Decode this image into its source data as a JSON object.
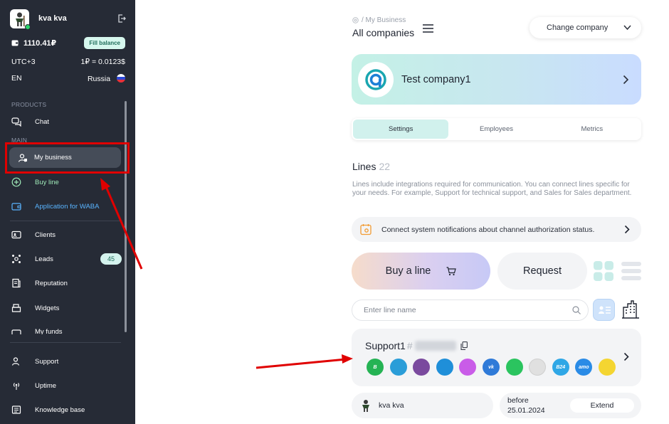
{
  "sidebar": {
    "user_name": "kva kva",
    "balance": "1110.41₽",
    "fill_balance_label": "Fill balance",
    "timezone": "UTC+3",
    "rate": "1₽ = 0.0123$",
    "language": "EN",
    "country": "Russia",
    "products_label": "PRODUCTS",
    "main_label": "MAIN",
    "items": [
      {
        "label": "Chat",
        "icon": "chat-icon"
      },
      {
        "label": "My business",
        "icon": "business-icon",
        "active": true
      },
      {
        "label": "Buy line",
        "icon": "plus-circle-icon"
      },
      {
        "label": "Application for WABA",
        "icon": "wallet-icon"
      },
      {
        "label": "Clients",
        "icon": "id-card-icon"
      },
      {
        "label": "Leads",
        "icon": "leads-icon",
        "badge": "45"
      },
      {
        "label": "Reputation",
        "icon": "reputation-icon"
      },
      {
        "label": "Widgets",
        "icon": "widget-icon"
      },
      {
        "label": "My funds",
        "icon": "funds-icon"
      },
      {
        "label": "Support",
        "icon": "support-icon"
      },
      {
        "label": "Uptime",
        "icon": "uptime-icon"
      },
      {
        "label": "Knowledge base",
        "icon": "book-icon"
      }
    ]
  },
  "header": {
    "breadcrumb": "/ My Business",
    "title": "All companies",
    "change_company_label": "Change company"
  },
  "company": {
    "name": "Test company1"
  },
  "tabs": [
    {
      "label": "Settings",
      "active": true
    },
    {
      "label": "Employees"
    },
    {
      "label": "Metrics"
    }
  ],
  "lines": {
    "title": "Lines",
    "count": "22",
    "description": "Lines include integrations required for communication. You can connect lines specific for your needs. For example, Support for technical support, and Sales for Sales department.",
    "notification_text": "Connect system notifications about channel authorization status.",
    "buy_label": "Buy a line",
    "request_label": "Request",
    "search_placeholder": "Enter line name"
  },
  "line_card": {
    "name": "Support1",
    "hash": "#",
    "channels": [
      {
        "name": "whatsapp-business",
        "color": "#25b354",
        "glyph": "B"
      },
      {
        "name": "telegram",
        "color": "#2a9dd8",
        "glyph": ""
      },
      {
        "name": "viber",
        "color": "#7a4a9e",
        "glyph": ""
      },
      {
        "name": "avito",
        "color": "#1f8fd9",
        "glyph": ""
      },
      {
        "name": "instagram",
        "color": "#c95ce8",
        "glyph": ""
      },
      {
        "name": "vk",
        "color": "#2f7ad8",
        "glyph": "vk"
      },
      {
        "name": "whatsapp",
        "color": "#2bc45f",
        "glyph": ""
      },
      {
        "name": "email",
        "color": "#e0e0e0",
        "glyph": ""
      },
      {
        "name": "bitrix24",
        "color": "#2fa7e6",
        "glyph": "B24"
      },
      {
        "name": "amocrm",
        "color": "#2a8be6",
        "glyph": "amo"
      },
      {
        "name": "yandex-tasks",
        "color": "#f4d531",
        "glyph": ""
      }
    ],
    "owner_name": "kva kva",
    "expiry_label": "before",
    "expiry_date": "25.01.2024",
    "extend_label": "Extend"
  },
  "colors": {
    "sidebar_bg": "#262b36",
    "accent_teal": "#d1f1ed",
    "annotation_red": "#e00000"
  }
}
